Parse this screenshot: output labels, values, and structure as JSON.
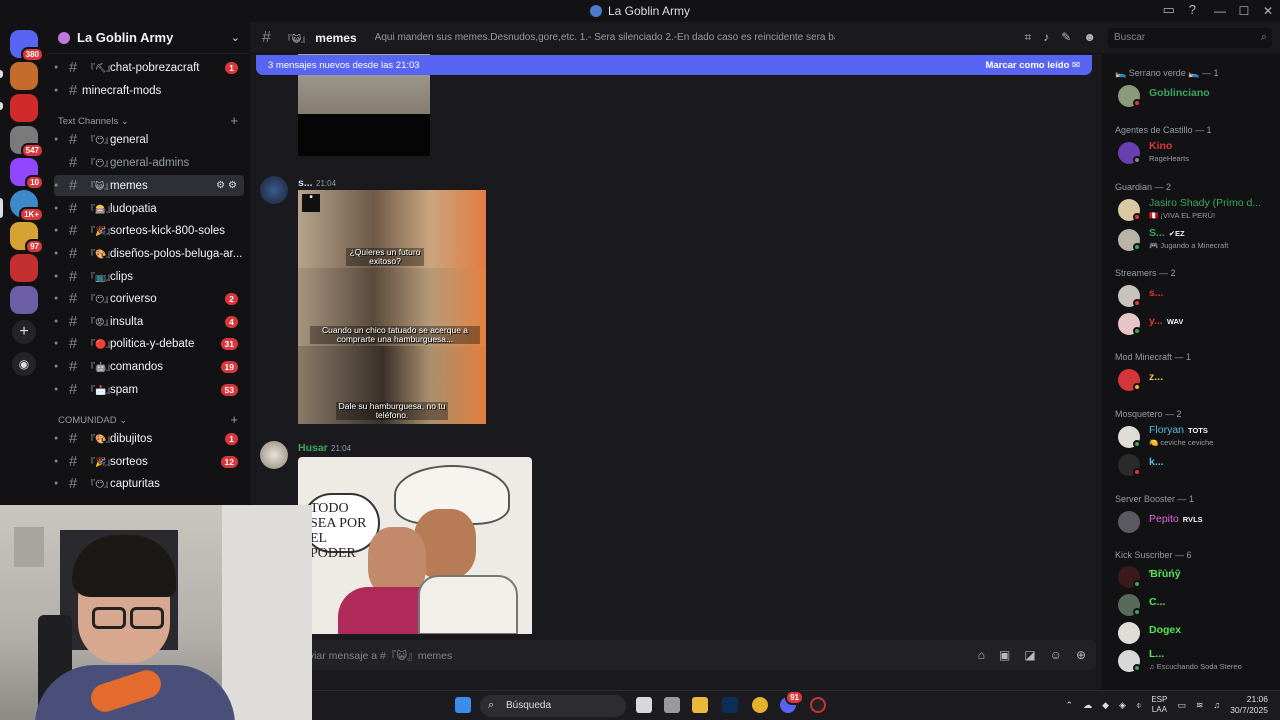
{
  "window": {
    "title": "La Goblin Army",
    "controls": [
      "—",
      "☐",
      "✕"
    ]
  },
  "guilds": [
    {
      "badge": "380",
      "color": "#5865f2"
    },
    {
      "badge": "",
      "color": "#c46b2e"
    },
    {
      "badge": "",
      "color": "#d02a2a"
    },
    {
      "badge": "547",
      "color": "#7a7a7a"
    },
    {
      "badge": "10",
      "color": "#9146ff"
    },
    {
      "badge": "1K+",
      "color": "#3e8ac9"
    },
    {
      "badge": "97",
      "color": "#d6a234"
    },
    {
      "badge": "",
      "color": "#c43030"
    },
    {
      "badge": "",
      "color": "#6d5ea8"
    }
  ],
  "server": {
    "name": "La Goblin Army",
    "top_channels": [
      {
        "emoji": "『⛏』",
        "name": "chat-pobrezacraft",
        "count": "1",
        "unread": true
      },
      {
        "emoji": "",
        "name": "minecraft-mods",
        "count": "",
        "unread": true
      }
    ],
    "category_text": "Text Channels",
    "text_channels": [
      {
        "emoji": "『😶』",
        "name": "general",
        "count": "",
        "unread": true
      },
      {
        "emoji": "『😶』",
        "name": "general-admins",
        "count": "",
        "unread": false
      },
      {
        "emoji": "『😺』",
        "name": "memes",
        "count": "",
        "unread": true,
        "active": true
      },
      {
        "emoji": "『🎰』",
        "name": "ludopatia",
        "count": "",
        "unread": true
      },
      {
        "emoji": "『🎉』",
        "name": "sorteos-kick-800-soles",
        "count": "",
        "unread": true
      },
      {
        "emoji": "『🎨』",
        "name": "diseños-polos-beluga-ar...",
        "count": "",
        "unread": true
      },
      {
        "emoji": "『📺』",
        "name": "clips",
        "count": "",
        "unread": true
      },
      {
        "emoji": "『😶』",
        "name": "coriverso",
        "count": "2",
        "unread": true
      },
      {
        "emoji": "『😡』",
        "name": "insulta",
        "count": "4",
        "unread": true
      },
      {
        "emoji": "『🔴』",
        "name": "politica-y-debate",
        "count": "31",
        "unread": true
      },
      {
        "emoji": "『🤖』",
        "name": "comandos",
        "count": "19",
        "unread": true
      },
      {
        "emoji": "『📩』",
        "name": "spam",
        "count": "53",
        "unread": true
      }
    ],
    "category_community": "COMUNIDAD",
    "community_channels": [
      {
        "emoji": "『🎨』",
        "name": "dibujitos",
        "count": "1",
        "unread": true
      },
      {
        "emoji": "『🎉』",
        "name": "sorteos",
        "count": "12",
        "unread": true
      },
      {
        "emoji": "『😶』",
        "name": "capturitas",
        "count": "",
        "unread": true
      }
    ]
  },
  "channel": {
    "emoji": "『😺』",
    "name": "memes",
    "topic": "Aqui manden sus memes.Desnudos,gore,etc. 1.- Sera silenciado 2.-En dado caso es reincidente sera baneado"
  },
  "search_placeholder": "Buscar",
  "new_messages_bar": {
    "text": "3 mensajes nuevos desde las 21:03",
    "action": "Marcar como leído"
  },
  "messages": [
    {
      "author": "s...",
      "time": "21:04",
      "author_color": "#d0d6ff",
      "meme_captions": [
        "¿Quieres un futuro exitoso?",
        "Cuando un chico tatuado se acerque a comprarte una hamburguesa...",
        "Dale su hamburguesa, no tu teléfono."
      ]
    },
    {
      "author": "Husar",
      "time": "21:04",
      "author_color": "#3ba55c",
      "image_text": "TODO SEA POR EL PODER"
    }
  ],
  "composer_placeholder": "Enviar mensaje a #『😺』memes",
  "members": {
    "groups": [
      {
        "title": "🛌 Serrano verde 🛌 — 1",
        "items": [
          {
            "name": "Goblinciano",
            "color": "#3ba55c",
            "status": "",
            "tag": ""
          }
        ]
      },
      {
        "title": "Agentes de Castillo — 1",
        "items": [
          {
            "name": "Kino",
            "color": "#da373c",
            "status": "RageHearts",
            "tag": ""
          }
        ]
      },
      {
        "title": "Guardian — 2",
        "items": [
          {
            "name": "Jasiro Shady (Primo d...",
            "color": "#3ba55c",
            "status": "🇵🇪 ¡VIVA EL PERÚ!",
            "tag": ""
          },
          {
            "name": "S...",
            "color": "#3ba55c",
            "status": "🎮 Jugando a Minecraft",
            "tag": "✔EZ"
          }
        ]
      },
      {
        "title": "Streamers — 2",
        "items": [
          {
            "name": "s...",
            "color": "#da373c",
            "status": "",
            "tag": ""
          },
          {
            "name": "y...",
            "color": "#da373c",
            "status": "",
            "tag": "WAV"
          }
        ]
      },
      {
        "title": "Mod Minecraft — 1",
        "items": [
          {
            "name": "z...",
            "color": "#e8c547",
            "status": "",
            "tag": ""
          }
        ]
      },
      {
        "title": "Mosquetero — 2",
        "items": [
          {
            "name": "Floryan",
            "color": "#5cb8e6",
            "status": "🍋 ceviche ceviche",
            "tag": "TOTS"
          },
          {
            "name": "k...",
            "color": "#5cb8e6",
            "status": "",
            "tag": ""
          }
        ]
      },
      {
        "title": "Server Booster — 1",
        "items": [
          {
            "name": "Pepito",
            "color": "#e066e0",
            "status": "",
            "tag": "RVLS"
          }
        ]
      },
      {
        "title": "Kick Suscriber — 6",
        "items": [
          {
            "name": "Ɓȓủńŷ",
            "color": "#55e655",
            "status": "",
            "tag": ""
          },
          {
            "name": "C...",
            "color": "#55e655",
            "status": "",
            "tag": ""
          },
          {
            "name": "Dogex",
            "color": "#55e655",
            "status": "",
            "tag": ""
          },
          {
            "name": "L...",
            "color": "#55e655",
            "status": "♫ Escuchando Soda Stereo",
            "tag": ""
          }
        ]
      }
    ]
  },
  "taskbar": {
    "search": "Búsqueda",
    "lang_top": "ESP",
    "lang_bottom": "LAA",
    "time": "21:06",
    "date": "30/7/2025",
    "discord_badge": "91"
  }
}
